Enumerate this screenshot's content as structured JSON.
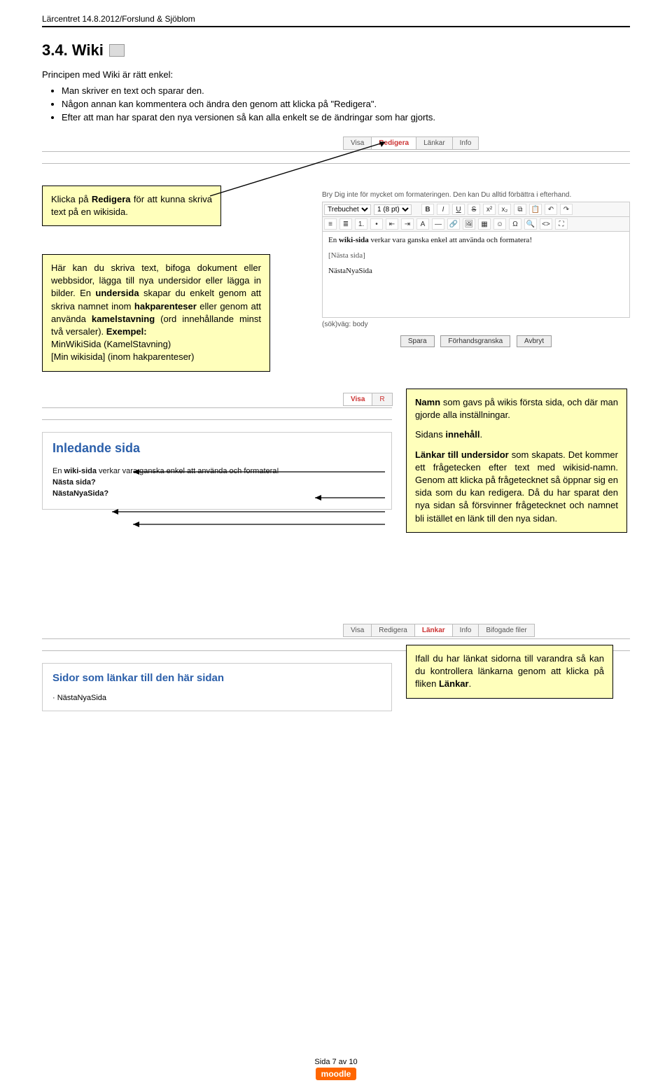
{
  "header": "Lärcentret 14.8.2012/Forslund & Sjöblom",
  "section": {
    "num": "3.4. Wiki"
  },
  "intro": "Principen med Wiki är rätt enkel:",
  "bullets": [
    "Man skriver en text och sparar den.",
    "Någon annan kan kommentera och ändra den genom att klicka på \"Redigera\".",
    "Efter att man har sparat den nya versionen så kan alla enkelt se de ändringar som har gjorts."
  ],
  "tabs": {
    "visa": "Visa",
    "redigera": "Redigera",
    "lankar": "Länkar",
    "info": "Info",
    "bifogade": "Bifogade filer"
  },
  "callout1": {
    "pre": "Klicka på ",
    "b": "Redigera",
    "post": " för att kunna skriva text på en wikisida."
  },
  "callout2": {
    "p1a": "Här kan du skriva text, bifoga dokument eller webbsidor, lägga till nya undersidor eller lägga in bilder. En ",
    "p1b": "undersida",
    "p1c": " skapar du enkelt genom att skriva namnet inom ",
    "p1d": "hakparenteser",
    "p1e": " eller genom att använda ",
    "p1f": "kamelstavning",
    "p1g": " (ord innehållande minst två versaler). ",
    "p1h": "Exempel:",
    "ex1": "MinWikiSida (KamelStavning)",
    "ex2": "[Min wikisida] (inom hakparenteser)"
  },
  "editor": {
    "hint": "Bry Dig inte för mycket om formateringen. Den kan Du alltid förbättra i efterhand.",
    "font": "Trebuchet",
    "size": "1 (8 pt)",
    "l1a": "En ",
    "l1b": "wiki-sida",
    "l1c": " verkar vara ganska enkel att använda och formatera!",
    "l2": "[Nästa sida]",
    "l3": "NästaNyaSida",
    "path_lbl": "(sök)väg:",
    "path": "body",
    "b_save": "Spara",
    "b_prev": "Förhandsgranska",
    "b_cancel": "Avbryt"
  },
  "view": {
    "title": "Inledande sida",
    "l1a": "En ",
    "l1b": "wiki-sida",
    "l1c": " verkar vara ganska enkel att använda och formatera!",
    "l2": "Nästa sida?",
    "l3": "NästaNyaSida?"
  },
  "callout3": {
    "p1a": "Namn",
    "p1b": " som gavs på wikis första sida, och där man gjorde alla inställningar.",
    "p2a": "Sidans ",
    "p2b": "innehåll",
    "p2c": ".",
    "p3a": "Länkar till undersidor",
    "p3b": " som skapats. Det kommer ett frågetecken efter text med wikisid-namn. Genom att klicka på frågetecknet så öppnar sig en sida som du kan redigera. Då du har sparat den nya sidan så försvinner frågetecknet och namnet bli istället en länk till den nya sidan."
  },
  "links": {
    "title": "Sidor som länkar till den här sidan",
    "item": "· NästaNyaSida"
  },
  "callout4": {
    "t1": "Ifall du har länkat sidorna till varandra så kan du kontrollera länkarna genom att klicka på fliken ",
    "t2": "Länkar",
    "t3": "."
  },
  "footer": {
    "page": "Sida 7 av 10",
    "logo": "moodle"
  }
}
